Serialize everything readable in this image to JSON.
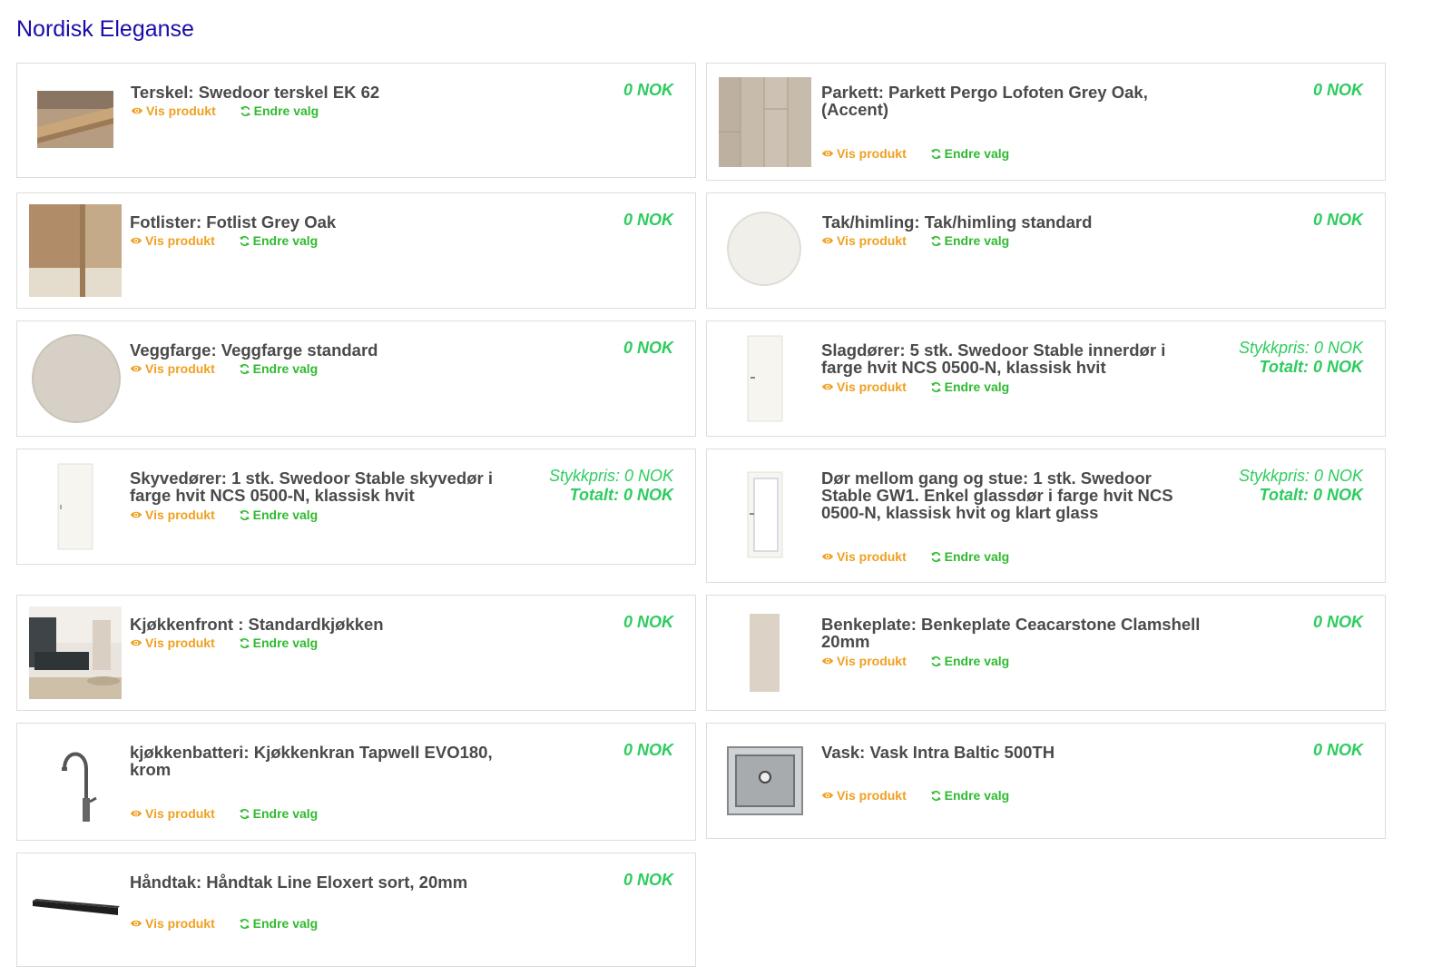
{
  "page": {
    "title": "Nordisk Eleganse"
  },
  "labels": {
    "vis_produkt": "Vis produkt",
    "endre_valg": "Endre valg"
  },
  "items": [
    {
      "title": "Terskel: Swedoor terskel EK 62",
      "price": "0 NOK",
      "thumb": "threshold"
    },
    {
      "title": "Parkett: Parkett Pergo Lofoten Grey Oak, (Accent)",
      "price": "0 NOK",
      "thumb": "parquet"
    },
    {
      "title": "Fotlister: Fotlist Grey Oak",
      "price": "0 NOK",
      "thumb": "baseboard"
    },
    {
      "title": "Tak/himling: Tak/himling standard",
      "price": "0 NOK",
      "thumb": "ceiling-swatch"
    },
    {
      "title": "Veggfarge: Veggfarge standard",
      "price": "0 NOK",
      "thumb": "wall-swatch"
    },
    {
      "title": "Slagdører: 5 stk. Swedoor Stable innerdør i farge hvit NCS 0500-N, klassisk hvit",
      "unit_price": "Stykkpris: 0 NOK",
      "total": "Totalt: 0 NOK",
      "thumb": "door"
    },
    {
      "title": "Skyvedører: 1 stk. Swedoor Stable skyvedør i farge hvit NCS 0500-N, klassisk hvit",
      "unit_price": "Stykkpris: 0 NOK",
      "total": "Totalt: 0 NOK",
      "thumb": "sliding-door"
    },
    {
      "title": "Dør mellom gang og stue: 1 stk. Swedoor Stable GW1. Enkel glassdør i farge hvit NCS 0500-N, klassisk hvit og klart glass",
      "unit_price": "Stykkpris: 0 NOK",
      "total": "Totalt: 0 NOK",
      "thumb": "glass-door"
    },
    {
      "title": "Kjøkkenfront : Standardkjøkken",
      "price": "0 NOK",
      "thumb": "kitchen"
    },
    {
      "title": "Benkeplate: Benkeplate Ceacarstone Clamshell 20mm",
      "price": "0 NOK",
      "thumb": "countertop"
    },
    {
      "title": "kjøkkenbatteri: Kjøkkenkran Tapwell EVO180, krom",
      "price": "0 NOK",
      "thumb": "faucet"
    },
    {
      "title": "Vask: Vask Intra Baltic 500TH",
      "price": "0 NOK",
      "thumb": "sink"
    },
    {
      "title": "Håndtak: Håndtak Line Eloxert sort, 20mm",
      "price": "0 NOK",
      "thumb": "handle"
    }
  ]
}
